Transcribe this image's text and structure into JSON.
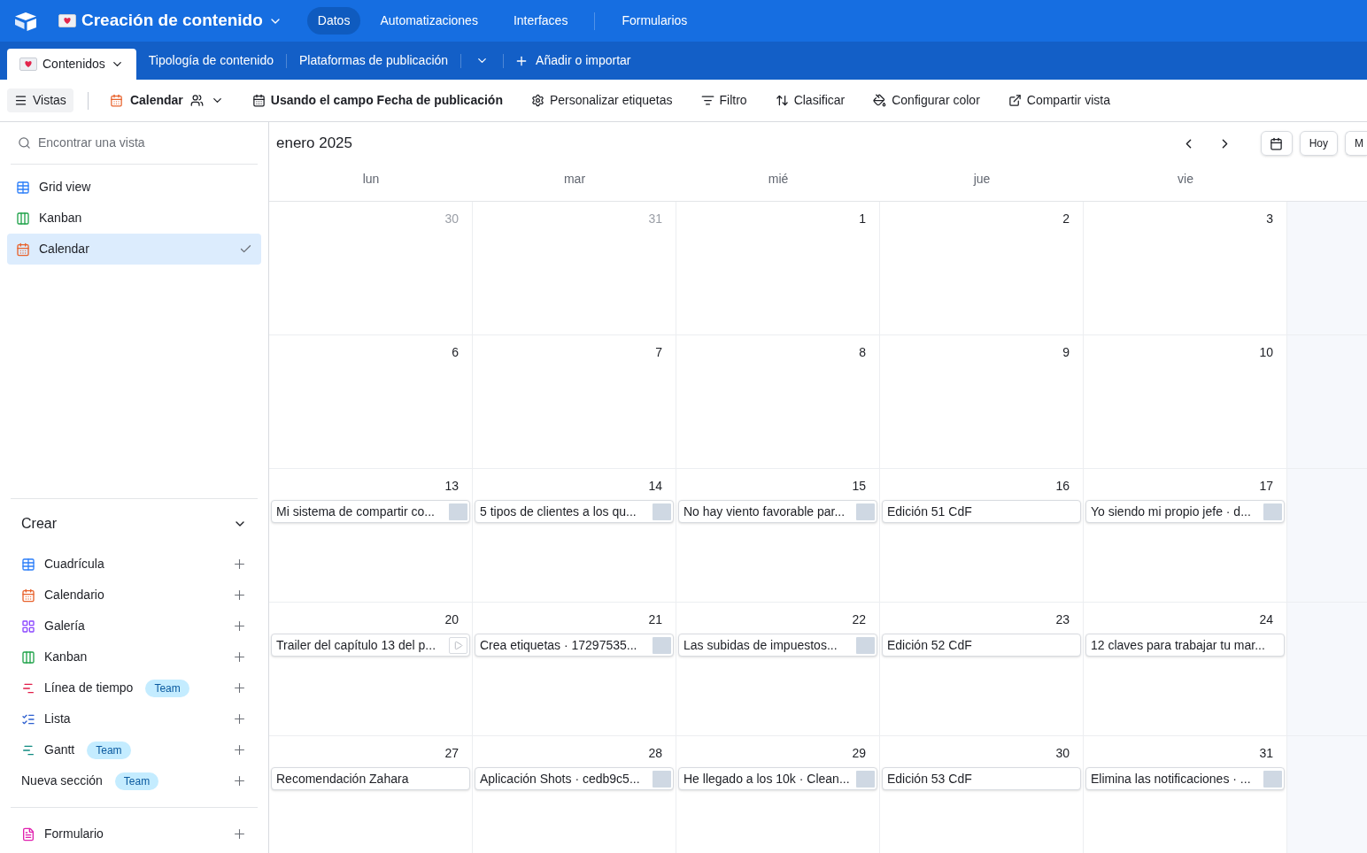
{
  "topbar": {
    "base_title": "Creación de contenido",
    "nav": [
      {
        "label": "Datos",
        "selected": true
      },
      {
        "label": "Automatizaciones",
        "selected": false
      },
      {
        "label": "Interfaces",
        "selected": false
      },
      {
        "label": "Formularios",
        "selected": false
      }
    ]
  },
  "tables": {
    "items": [
      {
        "label": "Contenidos",
        "selected": true
      },
      {
        "label": "Tipología de contenido",
        "selected": false
      },
      {
        "label": "Plataformas de publicación",
        "selected": false
      }
    ],
    "add": "Añadir o importar"
  },
  "toolbar": {
    "views": "Vistas",
    "view_name": "Calendar",
    "items": [
      {
        "kind": "date",
        "label": "Usando el campo Fecha de publicación"
      },
      {
        "kind": "labels",
        "label": "Personalizar etiquetas"
      },
      {
        "kind": "filter",
        "label": "Filtro"
      },
      {
        "kind": "sort",
        "label": "Clasificar"
      },
      {
        "kind": "color",
        "label": "Configurar color"
      },
      {
        "kind": "share",
        "label": "Compartir vista"
      }
    ]
  },
  "sidebar": {
    "search": {
      "placeholder": "Encontrar una vista"
    },
    "views": [
      {
        "kind": "grid",
        "label": "Grid view",
        "selected": false
      },
      {
        "kind": "kanban",
        "label": "Kanban",
        "selected": false
      },
      {
        "kind": "calendar",
        "label": "Calendar",
        "selected": true
      }
    ],
    "create": {
      "title": "Crear",
      "items": [
        {
          "kind": "grid",
          "label": "Cuadrícula"
        },
        {
          "kind": "calendar",
          "label": "Calendario"
        },
        {
          "kind": "gallery",
          "label": "Galería"
        },
        {
          "kind": "kanban",
          "label": "Kanban"
        },
        {
          "kind": "timeline",
          "label": "Línea de tiempo",
          "badge": "Team"
        },
        {
          "kind": "list",
          "label": "Lista"
        },
        {
          "kind": "gantt",
          "label": "Gantt",
          "badge": "Team"
        },
        {
          "kind": "section",
          "label": "Nueva sección",
          "badge": "Team"
        },
        {
          "kind": "form",
          "label": "Formulario"
        }
      ]
    }
  },
  "calendar": {
    "month": "enero 2025",
    "today": "Hoy",
    "cut_button": "M",
    "weekdays": [
      "lun",
      "mar",
      "mié",
      "jue",
      "vie"
    ],
    "weeks": [
      [
        {
          "day": "30",
          "outside": true
        },
        {
          "day": "31",
          "outside": true
        },
        {
          "day": "1",
          "outside": false
        },
        {
          "day": "2",
          "outside": false
        },
        {
          "day": "3",
          "outside": false
        }
      ],
      [
        {
          "day": "6",
          "outside": false
        },
        {
          "day": "7",
          "outside": false
        },
        {
          "day": "8",
          "outside": false
        },
        {
          "day": "9",
          "outside": false
        },
        {
          "day": "10",
          "outside": false
        }
      ],
      [
        {
          "day": "13",
          "outside": false,
          "event": {
            "title": "Mi sistema de compartir co...",
            "kind": "image"
          }
        },
        {
          "day": "14",
          "outside": false,
          "event": {
            "title": "5 tipos de clientes a los qu...",
            "kind": "image"
          }
        },
        {
          "day": "15",
          "outside": false,
          "event": {
            "title": "No hay viento favorable par...",
            "kind": "image"
          }
        },
        {
          "day": "16",
          "outside": false,
          "event": {
            "title": "Edición 51 CdF",
            "kind": "plain"
          }
        },
        {
          "day": "17",
          "outside": false,
          "event": {
            "title": "Yo siendo mi propio jefe · d...",
            "kind": "image"
          }
        }
      ],
      [
        {
          "day": "20",
          "outside": false,
          "event": {
            "title": "Trailer del capítulo 13 del p...",
            "kind": "video"
          }
        },
        {
          "day": "21",
          "outside": false,
          "event": {
            "title": "Crea etiquetas · 17297535...",
            "kind": "image"
          }
        },
        {
          "day": "22",
          "outside": false,
          "event": {
            "title": "Las subidas de impuestos...",
            "kind": "image"
          }
        },
        {
          "day": "23",
          "outside": false,
          "event": {
            "title": "Edición 52 CdF",
            "kind": "plain"
          }
        },
        {
          "day": "24",
          "outside": false,
          "event": {
            "title": "12 claves para trabajar tu mar...",
            "kind": "plain"
          }
        }
      ],
      [
        {
          "day": "27",
          "outside": false,
          "event": {
            "title": "Recomendación Zahara",
            "kind": "plain"
          }
        },
        {
          "day": "28",
          "outside": false,
          "event": {
            "title": "Aplicación Shots · cedb9c5...",
            "kind": "image"
          }
        },
        {
          "day": "29",
          "outside": false,
          "event": {
            "title": "He llegado a los 10k · Clean...",
            "kind": "image"
          }
        },
        {
          "day": "30",
          "outside": false,
          "event": {
            "title": "Edición 53 CdF",
            "kind": "plain"
          }
        },
        {
          "day": "31",
          "outside": false,
          "event": {
            "title": "Elimina las notificaciones · ...",
            "kind": "image"
          }
        }
      ]
    ]
  }
}
